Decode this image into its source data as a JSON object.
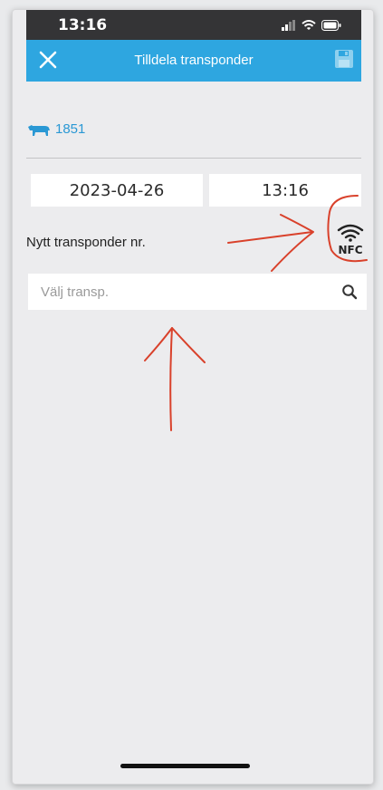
{
  "status_bar": {
    "time": "13:16",
    "icons": [
      "cellular-signal-icon",
      "wifi-icon",
      "battery-icon"
    ]
  },
  "app_bar": {
    "title": "Tilldela transponder",
    "close_icon": "close-icon",
    "save_icon": "save-icon",
    "color": "#2ea6e0"
  },
  "animal": {
    "icon": "cow-icon",
    "number": "1851",
    "color": "#2a98d4"
  },
  "date_time": {
    "date": "2023-04-26",
    "time": "13:16"
  },
  "transponder": {
    "label": "Nytt transponder nr.",
    "nfc_label": "NFC",
    "search_placeholder": "Välj transp.",
    "search_value": ""
  },
  "annotations": {
    "color": "#d9412b"
  }
}
